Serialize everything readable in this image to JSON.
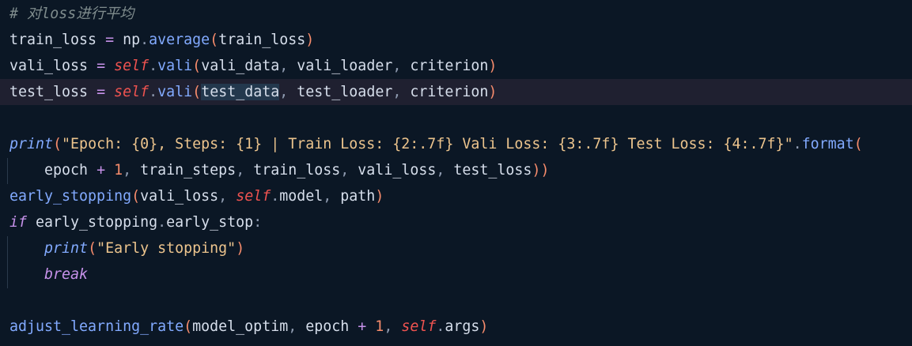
{
  "editor": {
    "colors": {
      "background": "#0b1725",
      "current_line": "#1f2030",
      "comment": "#7f8c8d",
      "identifier": "#d6deeb",
      "function": "#82aaff",
      "self": "#ef5350",
      "string": "#ecc48d",
      "number": "#f78c6c",
      "keyword": "#c792ea"
    },
    "lines": [
      {
        "tokens": [
          {
            "t": "# 对loss进行平均",
            "k": "comment"
          }
        ]
      },
      {
        "tokens": [
          {
            "t": "train_loss",
            "k": "id"
          },
          {
            "t": " = ",
            "k": "op"
          },
          {
            "t": "np",
            "k": "id"
          },
          {
            "t": ".",
            "k": "punc"
          },
          {
            "t": "average",
            "k": "fn"
          },
          {
            "t": "(",
            "k": "paren"
          },
          {
            "t": "train_loss",
            "k": "id"
          },
          {
            "t": ")",
            "k": "paren"
          }
        ]
      },
      {
        "tokens": [
          {
            "t": "vali_loss",
            "k": "id"
          },
          {
            "t": " = ",
            "k": "op"
          },
          {
            "t": "self",
            "k": "self"
          },
          {
            "t": ".",
            "k": "punc"
          },
          {
            "t": "vali",
            "k": "fn"
          },
          {
            "t": "(",
            "k": "paren"
          },
          {
            "t": "vali_data",
            "k": "id"
          },
          {
            "t": ", ",
            "k": "punc"
          },
          {
            "t": "vali_loader",
            "k": "id"
          },
          {
            "t": ", ",
            "k": "punc"
          },
          {
            "t": "criterion",
            "k": "id"
          },
          {
            "t": ")",
            "k": "paren"
          }
        ]
      },
      {
        "current": true,
        "tokens": [
          {
            "t": "test_loss",
            "k": "id"
          },
          {
            "t": " = ",
            "k": "op"
          },
          {
            "t": "self",
            "k": "self"
          },
          {
            "t": ".",
            "k": "punc"
          },
          {
            "t": "vali",
            "k": "fn"
          },
          {
            "t": "(",
            "k": "paren"
          },
          {
            "t": "test_data",
            "k": "id",
            "selected": true
          },
          {
            "t": ", ",
            "k": "punc"
          },
          {
            "t": "test_loader",
            "k": "id"
          },
          {
            "t": ", ",
            "k": "punc"
          },
          {
            "t": "criterion",
            "k": "id"
          },
          {
            "t": ")",
            "k": "paren"
          }
        ]
      },
      {
        "tokens": []
      },
      {
        "tokens": [
          {
            "t": "print",
            "k": "builtin"
          },
          {
            "t": "(",
            "k": "paren"
          },
          {
            "t": "\"Epoch: {0}, Steps: {1} | Train Loss: {2:.7f} Vali Loss: {3:.7f} Test Loss: {4:.7f}\"",
            "k": "str"
          },
          {
            "t": ".",
            "k": "punc"
          },
          {
            "t": "format",
            "k": "fn"
          },
          {
            "t": "(",
            "k": "paren"
          }
        ]
      },
      {
        "tokens": [
          {
            "t": "    ",
            "k": "id"
          },
          {
            "t": "epoch",
            "k": "id"
          },
          {
            "t": " + ",
            "k": "op"
          },
          {
            "t": "1",
            "k": "num"
          },
          {
            "t": ", ",
            "k": "punc"
          },
          {
            "t": "train_steps",
            "k": "id"
          },
          {
            "t": ", ",
            "k": "punc"
          },
          {
            "t": "train_loss",
            "k": "id"
          },
          {
            "t": ", ",
            "k": "punc"
          },
          {
            "t": "vali_loss",
            "k": "id"
          },
          {
            "t": ", ",
            "k": "punc"
          },
          {
            "t": "test_loss",
            "k": "id"
          },
          {
            "t": "))",
            "k": "paren"
          }
        ]
      },
      {
        "tokens": [
          {
            "t": "early_stopping",
            "k": "fn"
          },
          {
            "t": "(",
            "k": "paren"
          },
          {
            "t": "vali_loss",
            "k": "id"
          },
          {
            "t": ", ",
            "k": "punc"
          },
          {
            "t": "self",
            "k": "self"
          },
          {
            "t": ".",
            "k": "punc"
          },
          {
            "t": "model",
            "k": "id"
          },
          {
            "t": ", ",
            "k": "punc"
          },
          {
            "t": "path",
            "k": "id"
          },
          {
            "t": ")",
            "k": "paren"
          }
        ]
      },
      {
        "tokens": [
          {
            "t": "if",
            "k": "kw"
          },
          {
            "t": " early_stopping",
            "k": "id"
          },
          {
            "t": ".",
            "k": "punc"
          },
          {
            "t": "early_stop",
            "k": "id"
          },
          {
            "t": ":",
            "k": "punc"
          }
        ]
      },
      {
        "tokens": [
          {
            "t": "    ",
            "k": "id"
          },
          {
            "t": "print",
            "k": "builtin"
          },
          {
            "t": "(",
            "k": "paren"
          },
          {
            "t": "\"Early stopping\"",
            "k": "str"
          },
          {
            "t": ")",
            "k": "paren"
          }
        ]
      },
      {
        "tokens": [
          {
            "t": "    ",
            "k": "id"
          },
          {
            "t": "break",
            "k": "kw"
          }
        ]
      },
      {
        "tokens": []
      },
      {
        "tokens": [
          {
            "t": "adjust_learning_rate",
            "k": "fn"
          },
          {
            "t": "(",
            "k": "paren"
          },
          {
            "t": "model_optim",
            "k": "id"
          },
          {
            "t": ", ",
            "k": "punc"
          },
          {
            "t": "epoch",
            "k": "id"
          },
          {
            "t": " + ",
            "k": "op"
          },
          {
            "t": "1",
            "k": "num"
          },
          {
            "t": ", ",
            "k": "punc"
          },
          {
            "t": "self",
            "k": "self"
          },
          {
            "t": ".",
            "k": "punc"
          },
          {
            "t": "args",
            "k": "id"
          },
          {
            "t": ")",
            "k": "paren"
          }
        ]
      }
    ]
  }
}
